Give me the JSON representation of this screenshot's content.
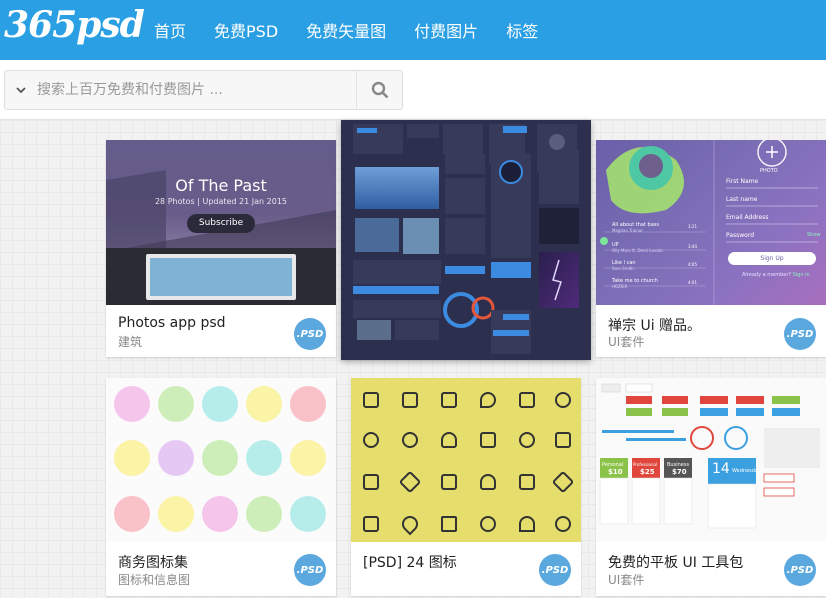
{
  "site": {
    "logo": "365psd"
  },
  "nav": [
    "首页",
    "免费PSD",
    "免费矢量图",
    "付费图片",
    "标签"
  ],
  "search": {
    "placeholder": "搜索上百万免费和付费图片 ..."
  },
  "colors": {
    "header": "#2a9fe3",
    "badge": "#5aa8de",
    "icons_bg": "#e5dd6c"
  },
  "cards": [
    {
      "title": "Photos app psd",
      "sub": "建筑",
      "badge": ".PSD",
      "thumb": {
        "heading": "Of The Past",
        "meta": "28 Photos | Updated 21 Jan 2015",
        "button": "Subscribe"
      }
    },
    {
      "title": "",
      "sub": "",
      "badge": ""
    },
    {
      "title": "禅宗 Ui 赠品。",
      "sub": "UI套件",
      "badge": ".PSD",
      "thumb": {
        "photo_label": "PHOTO",
        "first": "First Name",
        "last": "Last name",
        "email": "Email Address",
        "password": "Password",
        "show": "Show",
        "signup": "Sign Up",
        "already": "Already a member?",
        "signin": "Sign in",
        "tracks": [
          {
            "t": "All about that bass",
            "a": "Meghan Trainor",
            "d": "3:21"
          },
          {
            "t": "UP",
            "a": "Olly Murs ft. Demi Lovato",
            "d": "3:44"
          },
          {
            "t": "Like I can",
            "a": "Sam Smith",
            "d": "4:05"
          },
          {
            "t": "Take me to church",
            "a": "HOZIER",
            "d": "4:01"
          }
        ]
      }
    },
    {
      "title": "商务图标集",
      "sub": "图标和信息图",
      "badge": ".PSD"
    },
    {
      "title": "[PSD] 24 图标",
      "sub": "",
      "badge": ".PSD"
    },
    {
      "title": "免费的平板 UI 工具包",
      "sub": "UI套件",
      "badge": ".PSD",
      "thumb": {
        "prices": [
          {
            "name": "Personal",
            "price": "$10"
          },
          {
            "name": "Professional",
            "price": "$25"
          },
          {
            "name": "Business",
            "price": "$70"
          }
        ],
        "date": "14",
        "weekday": "Wednesday"
      }
    }
  ]
}
